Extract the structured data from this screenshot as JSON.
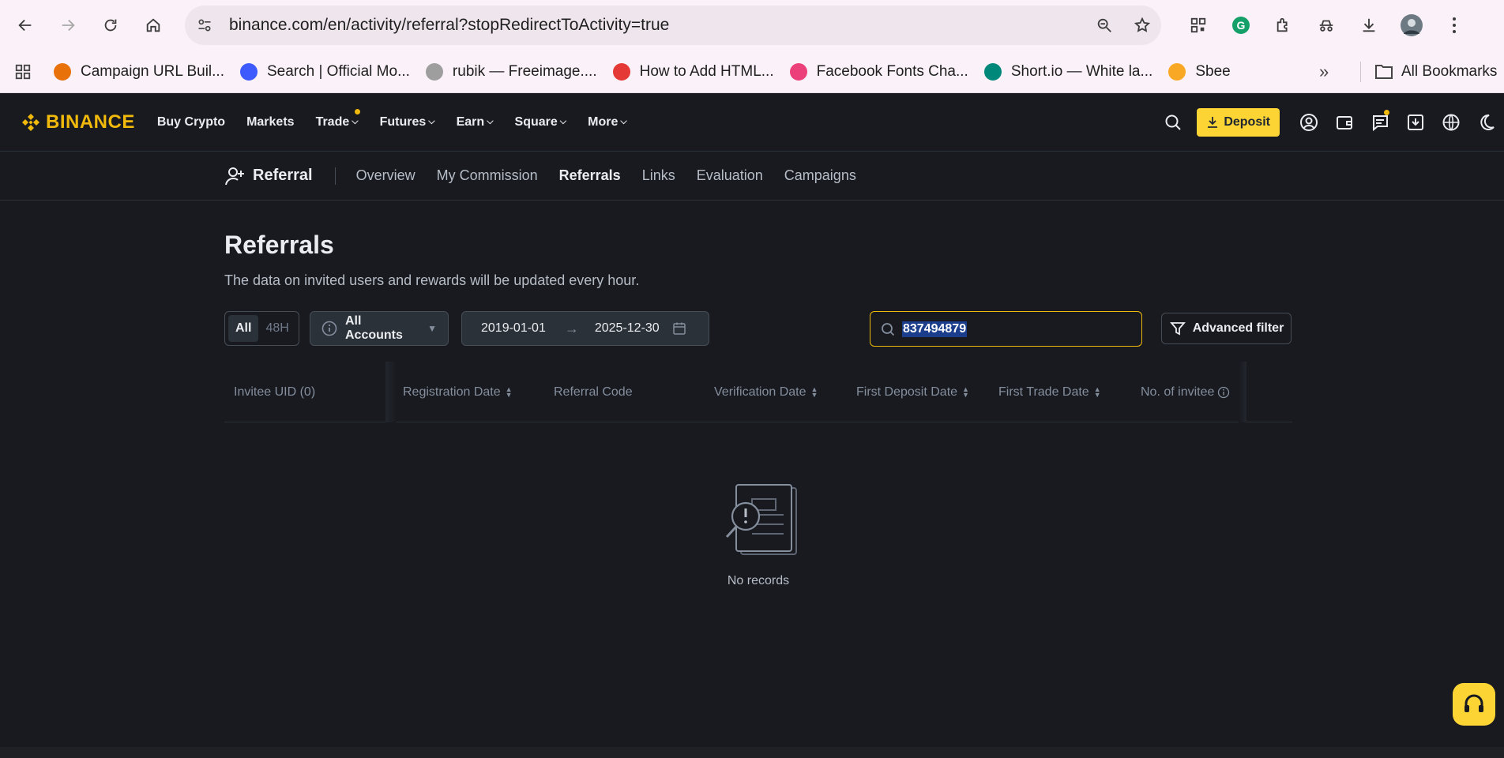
{
  "browser": {
    "url": "binance.com/en/activity/referral?stopRedirectToActivity=true",
    "bookmarks": [
      {
        "label": "Campaign URL Buil...",
        "color": "#e8710a"
      },
      {
        "label": "Search | Official Mo...",
        "color": "#3d5afe"
      },
      {
        "label": "rubik — Freeimage....",
        "color": "#9e9e9e"
      },
      {
        "label": "How to Add HTML...",
        "color": "#e53935"
      },
      {
        "label": "Facebook Fonts Cha...",
        "color": "#ec407a"
      },
      {
        "label": "Short.io — White la...",
        "color": "#00897b"
      },
      {
        "label": "Sbee",
        "color": "#f9a825"
      }
    ],
    "all_bookmarks": "All Bookmarks"
  },
  "header": {
    "logo": "BINANCE",
    "nav": [
      {
        "label": "Buy Crypto",
        "has_menu": false
      },
      {
        "label": "Markets",
        "has_menu": false
      },
      {
        "label": "Trade",
        "has_menu": true
      },
      {
        "label": "Futures",
        "has_menu": true
      },
      {
        "label": "Earn",
        "has_menu": true
      },
      {
        "label": "Square",
        "has_menu": true
      },
      {
        "label": "More",
        "has_menu": true
      }
    ],
    "deposit": "Deposit",
    "accent": "#fcd535"
  },
  "subnav": {
    "title": "Referral",
    "items": [
      "Overview",
      "My Commission",
      "Referrals",
      "Links",
      "Evaluation",
      "Campaigns"
    ],
    "active": "Referrals"
  },
  "page": {
    "title": "Referrals",
    "description": "The data on invited users and rewards will be updated every hour."
  },
  "filters": {
    "range_toggle": [
      "All",
      "48H"
    ],
    "accounts": "All Accounts",
    "date_from": "2019-01-01",
    "date_to": "2025-12-30",
    "search_value": "837494879",
    "advanced_filter": "Advanced filter"
  },
  "table": {
    "columns": [
      "Invitee UID (0)",
      "Registration Date",
      "Referral Code",
      "Verification Date",
      "First Deposit Date",
      "First Trade Date",
      "No. of invitee"
    ],
    "empty_text": "No records"
  }
}
